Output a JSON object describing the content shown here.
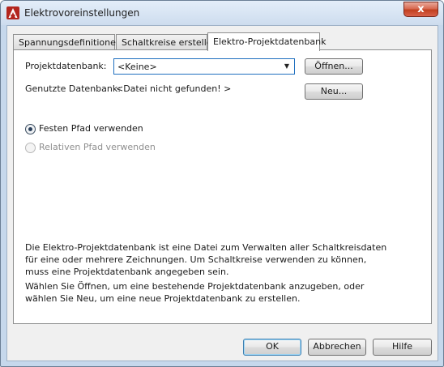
{
  "window": {
    "title": "Elektrovoreinstellungen",
    "close_glyph": "x"
  },
  "tabs": [
    {
      "label": "Spannungsdefinitionen",
      "active": false
    },
    {
      "label": "Schaltkreise erstellen",
      "active": false
    },
    {
      "label": "Elektro-Projektdatenbank",
      "active": true
    }
  ],
  "panel": {
    "project_db_label": "Projektdatenbank:",
    "project_db_value": "<Keine>",
    "open_button": "Öffnen...",
    "used_db_label": "Genutzte Datenbank:",
    "used_db_value": "<Datei nicht gefunden! >",
    "new_button": "Neu...",
    "radio_fixed": {
      "label": "Festen Pfad verwenden",
      "checked": true,
      "enabled": true
    },
    "radio_relative": {
      "label": "Relativen Pfad verwenden",
      "checked": false,
      "enabled": false
    },
    "description_1": "Die Elektro-Projektdatenbank ist eine Datei zum Verwalten aller Schaltkreisdaten für eine oder mehrere Zeichnungen. Um Schaltkreise verwenden zu können, muss eine Projektdatenbank angegeben sein.",
    "description_2": "Wählen Sie Öffnen, um eine bestehende Projektdatenbank anzugeben, oder wählen Sie Neu, um eine neue Projektdatenbank zu erstellen."
  },
  "footer": {
    "ok": "OK",
    "cancel": "Abbrechen",
    "help": "Hilfe"
  },
  "icons": {
    "app": "autocad-app-icon",
    "combo": "chevron-down-icon"
  }
}
